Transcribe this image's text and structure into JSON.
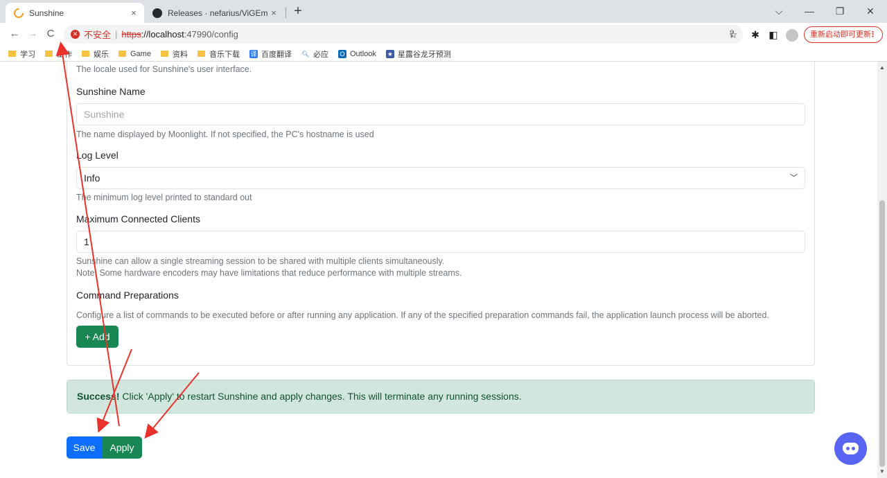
{
  "browser": {
    "tabs": [
      {
        "title": "Sunshine",
        "active": true
      },
      {
        "title": "Releases · nefarius/ViGEmBus",
        "active": false
      }
    ],
    "close_glyph": "×",
    "new_tab_glyph": "+",
    "window_controls": [
      "⌵",
      "—",
      "❐",
      "✕"
    ],
    "nav": {
      "back": "←",
      "forward": "→",
      "reload": "C"
    },
    "security_label": "不安全",
    "url": {
      "scheme": "https",
      "host": "://localhost",
      "path": ":47990/config"
    },
    "update_button": "重新启动即可更新",
    "update_menu": "⋮",
    "toolbar_icons": [
      "share-icon",
      "star-icon",
      "puzzle-icon",
      "sidepanel-icon",
      "profile-icon"
    ],
    "bookmarks": [
      {
        "label": "学习",
        "icon": "folder"
      },
      {
        "label": "工作",
        "icon": "folder"
      },
      {
        "label": "娱乐",
        "icon": "folder"
      },
      {
        "label": "Game",
        "icon": "folder"
      },
      {
        "label": "资料",
        "icon": "folder"
      },
      {
        "label": "音乐下载",
        "icon": "folder"
      },
      {
        "label": "百度翻译",
        "icon": "translate"
      },
      {
        "label": "必应",
        "icon": "search"
      },
      {
        "label": "Outlook",
        "icon": "outlook"
      },
      {
        "label": "星露谷龙牙预测",
        "icon": "stardew"
      }
    ]
  },
  "config": {
    "locale_help": "The locale used for Sunshine's user interface.",
    "sunshine_name": {
      "label": "Sunshine Name",
      "placeholder": "Sunshine",
      "help": "The name displayed by Moonlight. If not specified, the PC's hostname is used"
    },
    "log_level": {
      "label": "Log Level",
      "value": "Info",
      "help": "The minimum log level printed to standard out"
    },
    "max_clients": {
      "label": "Maximum Connected Clients",
      "value": "1",
      "help_line1": "Sunshine can allow a single streaming session to be shared with multiple clients simultaneously.",
      "help_line2": "Note: Some hardware encoders may have limitations that reduce performance with multiple streams."
    },
    "command_preps": {
      "label": "Command Preparations",
      "help": "Configure a list of commands to be executed before or after running any application. If any of the specified preparation commands fail, the application launch process will be aborted.",
      "add_button": "+ Add"
    },
    "alert": {
      "strong": "Success!",
      "text": " Click 'Apply' to restart Sunshine and apply changes. This will terminate any running sessions."
    },
    "save_button": "Save",
    "apply_button": "Apply"
  },
  "colors": {
    "primary": "#0d6efd",
    "success": "#198754",
    "alert_bg": "#d1e7dd",
    "annotation_arrow": "#e8322b",
    "discord": "#5865f2"
  }
}
